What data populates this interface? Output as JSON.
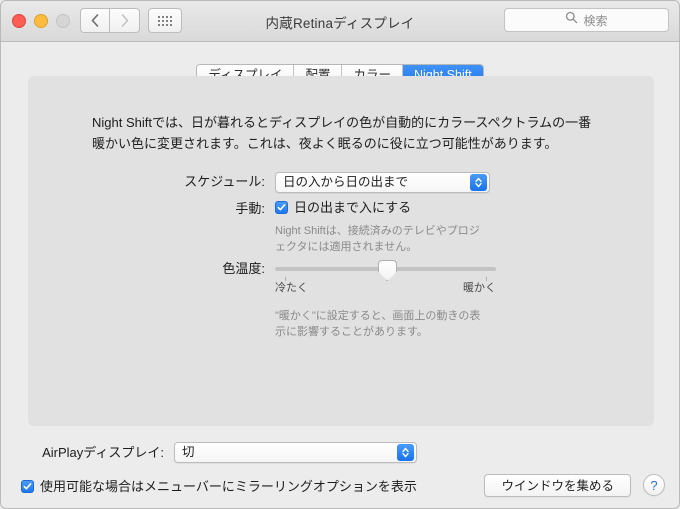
{
  "window": {
    "title": "内蔵Retinaディスプレイ",
    "traffic_lights": [
      "close",
      "minimize",
      "zoom"
    ],
    "nav": {
      "back_icon": "chevron-left-icon",
      "forward_icon": "chevron-right-icon"
    },
    "grid_button_icon": "grid-dots-icon",
    "search": {
      "placeholder": "検索",
      "icon": "search-icon",
      "value": ""
    }
  },
  "tabs": [
    {
      "label": "ディスプレイ",
      "selected": false
    },
    {
      "label": "配置",
      "selected": false
    },
    {
      "label": "カラー",
      "selected": false
    },
    {
      "label": "Night Shift",
      "selected": true
    }
  ],
  "panel": {
    "description": "Night Shiftでは、日が暮れるとディスプレイの色が自動的にカラースペクトラムの一番暖かい色に変更されます。これは、夜よく眠るのに役に立つ可能性があります。",
    "schedule": {
      "label": "スケジュール:",
      "value": "日の入から日の出まで",
      "stepper_icon": "chevron-up-down-icon"
    },
    "manual": {
      "label": "手動:",
      "checkbox_label": "日の出まで入にする",
      "checked": true,
      "check_icon": "checkmark-icon",
      "hint": "Night Shiftは、接続済みのテレビやプロジェクタには適用されません。"
    },
    "temperature": {
      "label": "色温度:",
      "value_percent": 51,
      "min_label": "冷たく",
      "max_label": "暖かく",
      "hint": "\"暖かく\"に設定すると、画面上の動きの表示に影響することがあります。"
    }
  },
  "bottom": {
    "airplay": {
      "label": "AirPlayディスプレイ:",
      "value": "切",
      "stepper_icon": "chevron-up-down-icon"
    },
    "mirroring": {
      "label": "使用可能な場合はメニューバーにミラーリングオプションを表示",
      "checked": true,
      "check_icon": "checkmark-icon"
    },
    "gather_button": "ウインドウを集める",
    "help_button": "?"
  },
  "colors": {
    "accent_blue": "#1f74ec",
    "window_bg": "#ececec",
    "panel_bg": "#e1e1e1",
    "text": "#1d1d1d",
    "hint_text": "#8a8a8a"
  }
}
